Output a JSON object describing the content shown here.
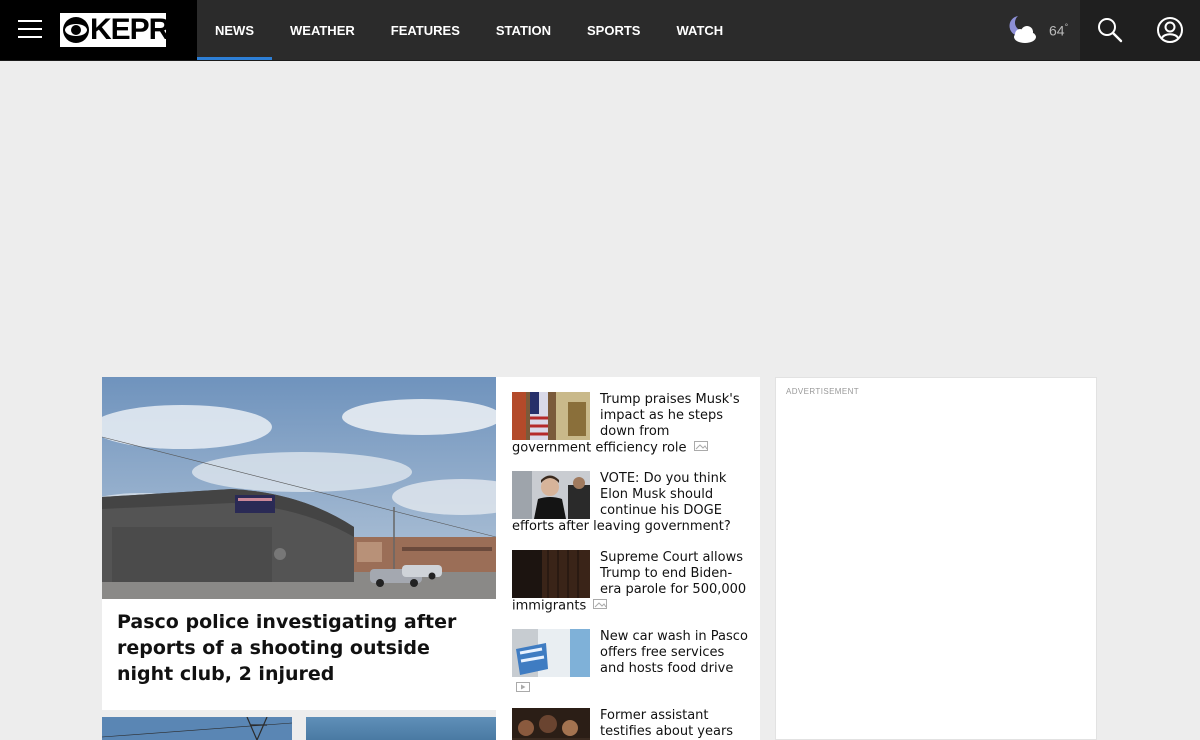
{
  "header": {
    "logo_text": "KEPR",
    "nav": [
      {
        "label": "NEWS",
        "active": true
      },
      {
        "label": "WEATHER",
        "active": false
      },
      {
        "label": "FEATURES",
        "active": false
      },
      {
        "label": "STATION",
        "active": false
      },
      {
        "label": "SPORTS",
        "active": false
      },
      {
        "label": "WATCH",
        "active": false
      }
    ],
    "weather": {
      "temp": "64",
      "degree": "°",
      "icon": "partly-cloudy-night-icon"
    },
    "accent_color": "#2d7fd6"
  },
  "lead_story": {
    "title": "Pasco police investigating after reports of a shooting outside night club, 2 injured"
  },
  "stories": [
    {
      "title": "Trump praises Musk's impact as he steps down from government efficiency role",
      "media": "gallery-icon"
    },
    {
      "title": "VOTE: Do you think Elon Musk should continue his DOGE efforts after leaving government?",
      "media": ""
    },
    {
      "title": "Supreme Court allows Trump to end Biden-era parole for 500,000 immigrants",
      "media": "gallery-icon"
    },
    {
      "title": "New car wash in Pasco offers free services and hosts food drive",
      "media": "video-icon"
    },
    {
      "title": "Former assistant testifies about years of",
      "media": ""
    }
  ],
  "sidebar": {
    "ad_label": "ADVERTISEMENT"
  }
}
